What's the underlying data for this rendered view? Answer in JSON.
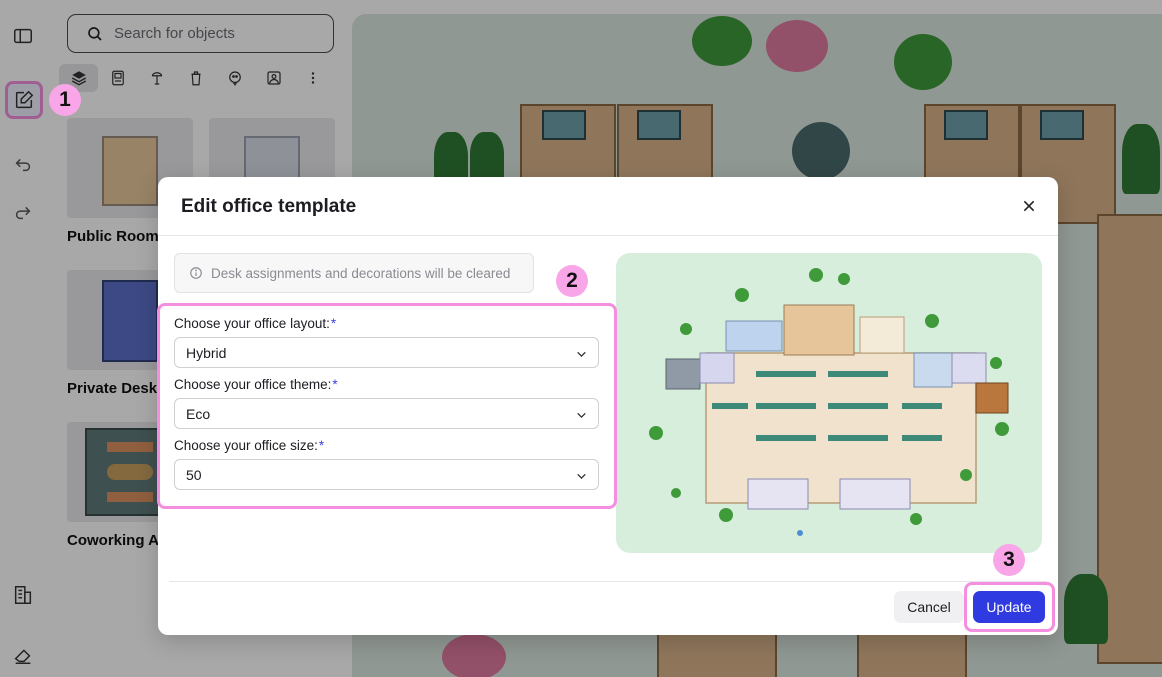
{
  "sidebar": {
    "buttons": [
      {
        "name": "panel-toggle",
        "icon": "sidebar-icon"
      },
      {
        "name": "edit",
        "icon": "edit-icon"
      },
      {
        "name": "undo",
        "icon": "undo-icon"
      },
      {
        "name": "redo",
        "icon": "redo-icon"
      },
      {
        "name": "building",
        "icon": "building-icon"
      },
      {
        "name": "eraser",
        "icon": "eraser-icon"
      }
    ]
  },
  "objects_panel": {
    "search_placeholder": "Search for objects",
    "categories": [
      "office-template-icon",
      "desk-icon",
      "plant-icon",
      "cup-icon",
      "sticker-icon",
      "image-icon",
      "more-icon"
    ],
    "templates": [
      {
        "label": "Public Room"
      },
      {
        "label": "Private Desk"
      },
      {
        "label": "Coworking A"
      }
    ]
  },
  "modal": {
    "title": "Edit office template",
    "notice": "Desk assignments and decorations will be cleared",
    "fields": [
      {
        "label": "Choose your office layout:",
        "required_mark": "*",
        "value": "Hybrid"
      },
      {
        "label": "Choose your office theme:",
        "required_mark": "*",
        "value": "Eco"
      },
      {
        "label": "Choose your office size:",
        "required_mark": "*",
        "value": "50"
      }
    ],
    "cancel_label": "Cancel",
    "update_label": "Update"
  },
  "annotations": {
    "step1": "1",
    "step2": "2",
    "step3": "3"
  },
  "colors": {
    "accent": "#2f3be0",
    "highlight": "#f48fe0",
    "badge": "#f9a6e9",
    "preview_bg": "#d8eedc"
  }
}
